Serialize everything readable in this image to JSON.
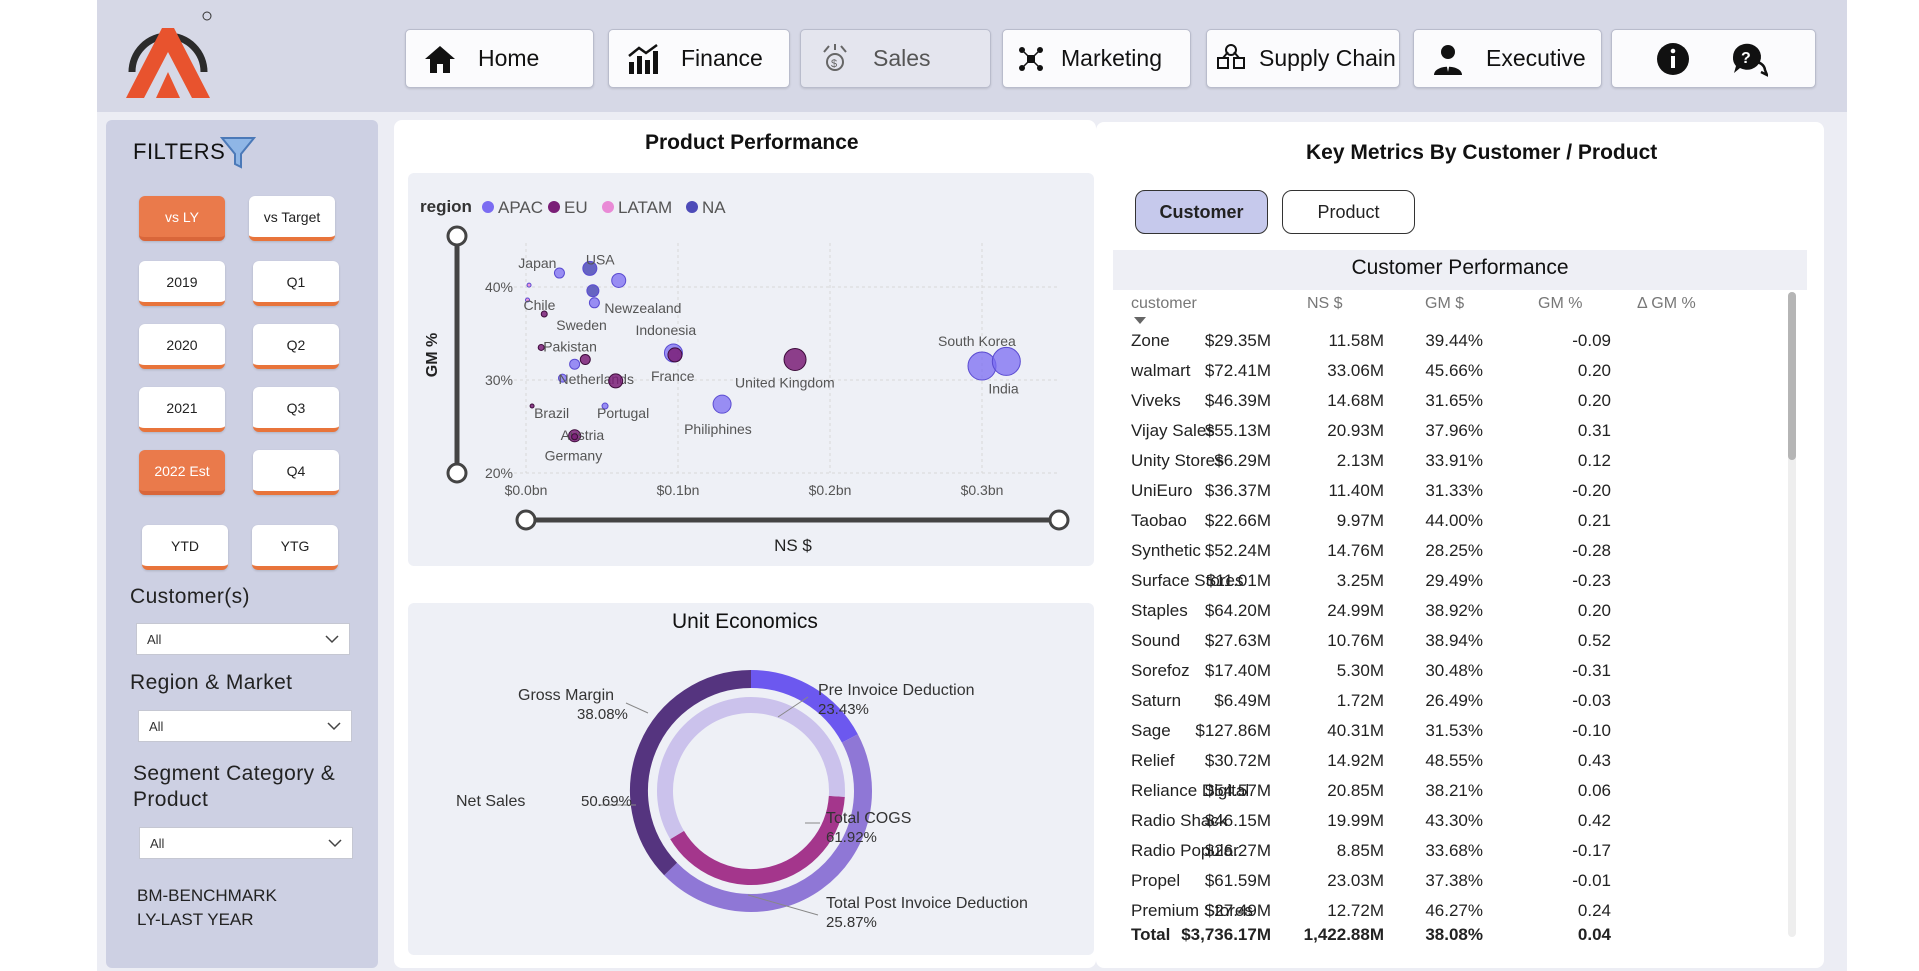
{
  "nav": [
    {
      "label": "Home",
      "icon": "home-icon"
    },
    {
      "label": "Finance",
      "icon": "finance-chart-icon"
    },
    {
      "label": "Sales",
      "icon": "sales-icon"
    },
    {
      "label": "Marketing",
      "icon": "marketing-icon"
    },
    {
      "label": "Supply Chain",
      "icon": "supply-chain-icon"
    },
    {
      "label": "Executive",
      "icon": "executive-icon"
    }
  ],
  "filters": {
    "title": "FILTERS",
    "compare": [
      "vs LY",
      "vs Target"
    ],
    "years": [
      "2019",
      "2020",
      "2021",
      "2022 Est"
    ],
    "quarters": [
      "Q1",
      "Q2",
      "Q3",
      "Q4"
    ],
    "periods": [
      "YTD",
      "YTG"
    ],
    "customer_label": "Customer(s)",
    "customer_value": "All",
    "region_label": "Region & Market",
    "region_value": "All",
    "segment_label_1": "Segment Category &",
    "segment_label_2": "Product",
    "segment_value": "All",
    "note1": "BM-BENCHMARK",
    "note2": "LY-LAST YEAR"
  },
  "product_performance": {
    "title": "Product Performance",
    "legend_title": "region",
    "chart_data": {
      "type": "scatter",
      "xlabel": "NS $",
      "ylabel": "GM %",
      "x_ticks": [
        "$0.0bn",
        "$0.1bn",
        "$0.2bn",
        "$0.3bn"
      ],
      "y_ticks": [
        "40%",
        "30%",
        "20%"
      ],
      "xlim": [
        0,
        0.35
      ],
      "ylim": [
        20,
        45
      ],
      "series": [
        {
          "name": "APAC",
          "color": "#7b6cf2"
        },
        {
          "name": "EU",
          "color": "#7a1f77"
        },
        {
          "name": "LATAM",
          "color": "#e98ad6"
        },
        {
          "name": "NA",
          "color": "#4d4bb8"
        }
      ],
      "points": [
        {
          "label": "Japan",
          "x": 0.022,
          "y": 41.5,
          "series": "APAC",
          "size": 5
        },
        {
          "label": "USA",
          "x": 0.042,
          "y": 42.0,
          "series": "NA",
          "size": 7
        },
        {
          "label": "",
          "x": 0.061,
          "y": 40.7,
          "series": "APAC",
          "size": 7
        },
        {
          "label": "",
          "x": 0.044,
          "y": 39.6,
          "series": "NA",
          "size": 6
        },
        {
          "label": "",
          "x": 0.002,
          "y": 40.2,
          "series": "LATAM",
          "size": 2
        },
        {
          "label": "Chile",
          "x": 0.001,
          "y": 38.6,
          "series": "LATAM",
          "size": 2
        },
        {
          "label": "Newzealand",
          "x": 0.045,
          "y": 38.3,
          "series": "APAC",
          "size": 5
        },
        {
          "label": "Sweden",
          "x": 0.012,
          "y": 37.1,
          "series": "EU",
          "size": 3
        },
        {
          "label": "Pakistan",
          "x": 0.01,
          "y": 33.5,
          "series": "EU",
          "size": 3
        },
        {
          "label": "",
          "x": 0.039,
          "y": 32.2,
          "series": "EU",
          "size": 5
        },
        {
          "label": "",
          "x": 0.032,
          "y": 31.7,
          "series": "APAC",
          "size": 5
        },
        {
          "label": "Netherlands",
          "x": 0.024,
          "y": 30.2,
          "series": "APAC",
          "size": 4
        },
        {
          "label": "",
          "x": 0.059,
          "y": 29.9,
          "series": "EU",
          "size": 7
        },
        {
          "label": "Brazil",
          "x": 0.004,
          "y": 27.2,
          "series": "EU",
          "size": 2
        },
        {
          "label": "Portugal",
          "x": 0.052,
          "y": 27.2,
          "series": "APAC",
          "size": 3
        },
        {
          "label": "Austria",
          "x": 0.032,
          "y": 24.0,
          "series": "EU",
          "size": 6
        },
        {
          "label": "Germany",
          "x": 0.032,
          "y": 23.9,
          "series": "EU",
          "size": 3
        },
        {
          "label": "Indonesia",
          "x": 0.097,
          "y": 32.9,
          "series": "APAC",
          "size": 9
        },
        {
          "label": "France",
          "x": 0.098,
          "y": 32.7,
          "series": "EU",
          "size": 7
        },
        {
          "label": "United Kingdom",
          "x": 0.177,
          "y": 32.2,
          "series": "EU",
          "size": 11
        },
        {
          "label": "Philiphines",
          "x": 0.129,
          "y": 27.4,
          "series": "APAC",
          "size": 9
        },
        {
          "label": "South Korea",
          "x": 0.3,
          "y": 31.5,
          "series": "APAC",
          "size": 14
        },
        {
          "label": "India",
          "x": 0.316,
          "y": 32.0,
          "series": "APAC",
          "size": 14
        }
      ]
    }
  },
  "unit_economics": {
    "title": "Unit Economics",
    "chart_data": {
      "type": "pie",
      "outer": [
        {
          "name": "Pre Invoice Deduction",
          "value": 23.43,
          "color": "#6c58ef"
        },
        {
          "name": "Total COGS",
          "value": 61.92,
          "color": "#8f77d6"
        },
        {
          "name": "Net Sales",
          "value": 50.69,
          "color": "#55347f"
        }
      ],
      "inner": [
        {
          "name": "Total Post Invoice Deduction",
          "value": 25.87,
          "color": "#a4368c"
        },
        {
          "name": "Gross Margin",
          "value": 38.08,
          "color": "#cbc2ec"
        }
      ],
      "labels": [
        {
          "name": "Gross Margin",
          "value": "38.08%"
        },
        {
          "name": "Pre Invoice Deduction",
          "value": "23.43%"
        },
        {
          "name": "Net Sales",
          "value": "50.69%"
        },
        {
          "name": "Total COGS",
          "value": "61.92%"
        },
        {
          "name": "Total Post Invoice Deduction",
          "value": "25.87%"
        }
      ]
    }
  },
  "key_metrics": {
    "title": "Key Metrics By Customer / Product",
    "tabs": [
      "Customer",
      "Product"
    ],
    "table_title": "Customer Performance",
    "columns": [
      "customer",
      "NS $",
      "GM $",
      "GM %",
      "Δ GM %"
    ],
    "rows": [
      [
        "Zone",
        "$29.35M",
        "11.58M",
        "39.44%",
        "-0.09"
      ],
      [
        "walmart",
        "$72.41M",
        "33.06M",
        "45.66%",
        "0.20"
      ],
      [
        "Viveks",
        "$46.39M",
        "14.68M",
        "31.65%",
        "0.20"
      ],
      [
        "Vijay Sales",
        "$55.13M",
        "20.93M",
        "37.96%",
        "0.31"
      ],
      [
        "Unity Stores",
        "$6.29M",
        "2.13M",
        "33.91%",
        "0.12"
      ],
      [
        "UniEuro",
        "$36.37M",
        "11.40M",
        "31.33%",
        "-0.20"
      ],
      [
        "Taobao",
        "$22.66M",
        "9.97M",
        "44.00%",
        "0.21"
      ],
      [
        "Synthetic",
        "$52.24M",
        "14.76M",
        "28.25%",
        "-0.28"
      ],
      [
        "Surface Stores",
        "$11.01M",
        "3.25M",
        "29.49%",
        "-0.23"
      ],
      [
        "Staples",
        "$64.20M",
        "24.99M",
        "38.92%",
        "0.20"
      ],
      [
        "Sound",
        "$27.63M",
        "10.76M",
        "38.94%",
        "0.52"
      ],
      [
        "Sorefoz",
        "$17.40M",
        "5.30M",
        "30.48%",
        "-0.31"
      ],
      [
        "Saturn",
        "$6.49M",
        "1.72M",
        "26.49%",
        "-0.03"
      ],
      [
        "Sage",
        "$127.86M",
        "40.31M",
        "31.53%",
        "-0.10"
      ],
      [
        "Relief",
        "$30.72M",
        "14.92M",
        "48.55%",
        "0.43"
      ],
      [
        "Reliance Digital",
        "$54.57M",
        "20.85M",
        "38.21%",
        "0.06"
      ],
      [
        "Radio Shack",
        "$46.15M",
        "19.99M",
        "43.30%",
        "0.42"
      ],
      [
        "Radio Popular",
        "$26.27M",
        "8.85M",
        "33.68%",
        "-0.17"
      ],
      [
        "Propel",
        "$61.59M",
        "23.03M",
        "37.38%",
        "-0.01"
      ],
      [
        "Premium Stores",
        "$27.49M",
        "12.72M",
        "46.27%",
        "0.24"
      ]
    ],
    "total": [
      "Total",
      "$3,736.17M",
      "1,422.88M",
      "38.08%",
      "0.04"
    ]
  }
}
